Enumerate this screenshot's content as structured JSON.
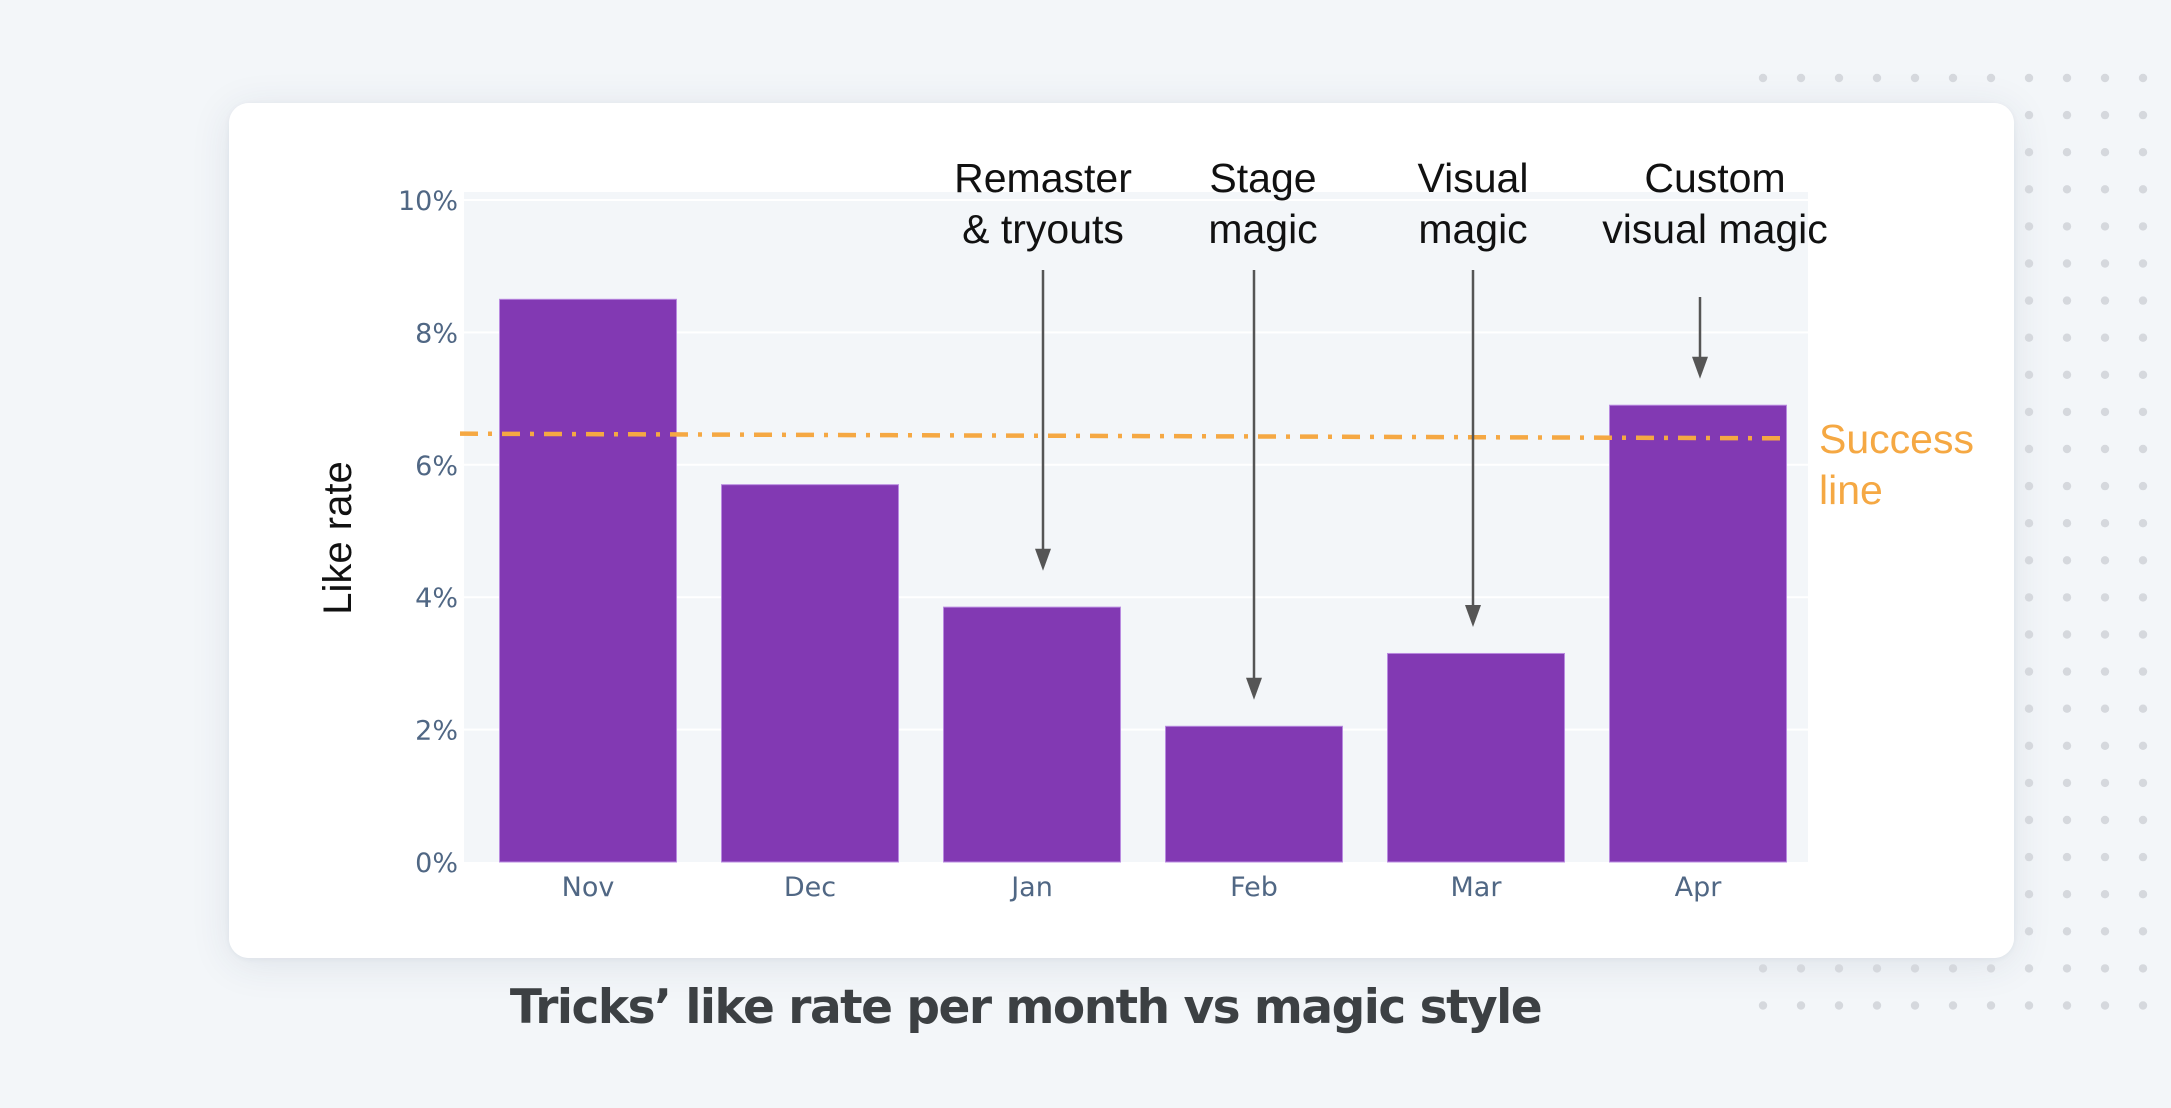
{
  "caption": "Tricks’ like rate per month vs magic style",
  "colors": {
    "bar": "#8239b3",
    "success_line": "#f5a843",
    "plot_bg": "#f3f6f9",
    "grid": "#ffffff",
    "annotation_arrow": "#555555"
  },
  "chart_data": {
    "type": "bar",
    "title": "",
    "xlabel": "",
    "ylabel": "Like rate",
    "categories": [
      "Nov",
      "Dec",
      "Jan",
      "Feb",
      "Mar",
      "Apr"
    ],
    "values": [
      8.5,
      5.7,
      3.85,
      2.05,
      3.15,
      6.9
    ],
    "value_unit": "%",
    "ylim": [
      0,
      10
    ],
    "yticks": [
      0,
      2,
      4,
      6,
      8,
      10
    ],
    "ytick_labels": [
      "0%",
      "2%",
      "4%",
      "6%",
      "8%",
      "10%"
    ],
    "grid": true,
    "reference_line": {
      "label_lines": [
        "Success",
        "line"
      ],
      "y_start": 6.47,
      "y_end": 6.4,
      "style": "dash-dot"
    },
    "annotations": [
      {
        "category": "Jan",
        "lines": [
          "Remaster",
          "& tryouts"
        ],
        "arrow_to": 4.4
      },
      {
        "category": "Feb",
        "lines": [
          "Stage",
          "magic"
        ],
        "arrow_to": 2.45
      },
      {
        "category": "Mar",
        "lines": [
          "Visual",
          "magic"
        ],
        "arrow_to": 3.55
      },
      {
        "category": "Apr",
        "lines": [
          "Custom",
          "visual magic"
        ],
        "arrow_to": 7.3
      }
    ]
  }
}
